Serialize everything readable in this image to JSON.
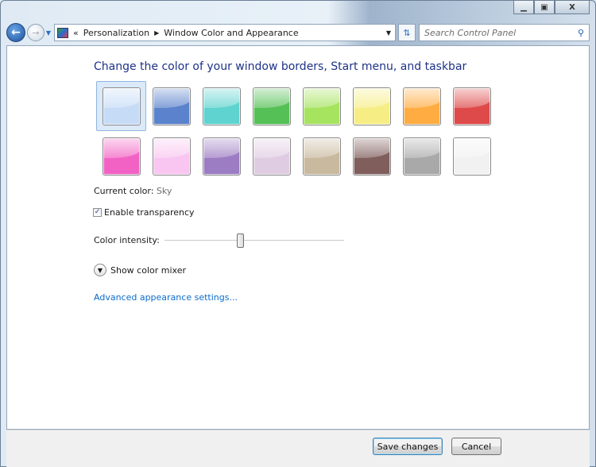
{
  "window": {
    "minimize_icon": "minimize-icon",
    "maximize_icon": "maximize-icon",
    "close_label": "X"
  },
  "nav": {
    "breadcrumb": [
      "Personalization",
      "Window Color and Appearance"
    ],
    "overflow": "«",
    "search_placeholder": "Search Control Panel"
  },
  "main": {
    "title": "Change the color of your window borders, Start menu, and taskbar",
    "swatches": [
      {
        "color": "#c6dcf6",
        "selected": true
      },
      {
        "color": "#5b82cc"
      },
      {
        "color": "#5fd3cf"
      },
      {
        "color": "#55c055"
      },
      {
        "color": "#a6e35f"
      },
      {
        "color": "#f6ee85"
      },
      {
        "color": "#ffac42"
      },
      {
        "color": "#de4a4a"
      },
      {
        "color": "#f262c4"
      },
      {
        "color": "#f8c6f0"
      },
      {
        "color": "#9c7cc2"
      },
      {
        "color": "#e0cce2"
      },
      {
        "color": "#c9b99e"
      },
      {
        "color": "#7f5e5c"
      },
      {
        "color": "#a9a9a9"
      },
      {
        "color": "#f1f1f1"
      }
    ],
    "current_color_label": "Current color:",
    "current_color_value": "Sky",
    "transparency_label": "Enable transparency",
    "transparency_checked": true,
    "intensity_label": "Color intensity:",
    "intensity_value": 0.42,
    "mixer_label": "Show color mixer",
    "advanced_link": "Advanced appearance settings..."
  },
  "footer": {
    "save_label": "Save changes",
    "cancel_label": "Cancel"
  }
}
